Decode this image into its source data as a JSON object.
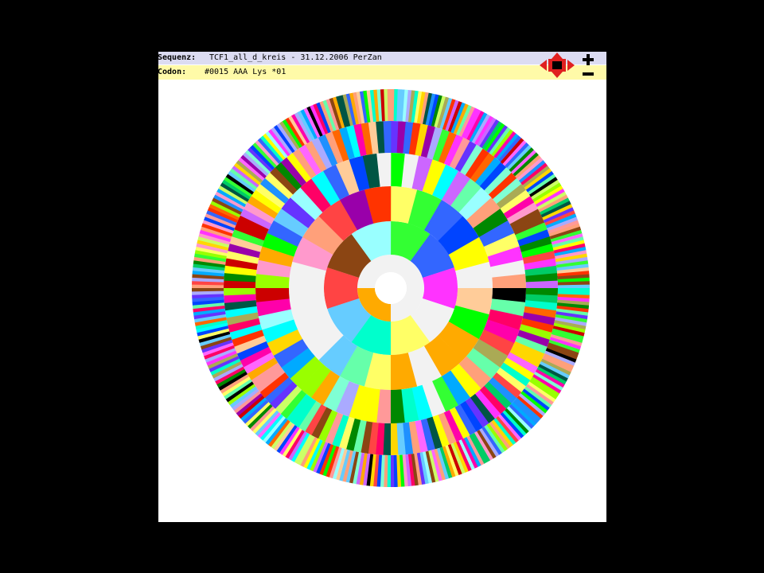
{
  "sequence": {
    "label": "Sequenz:",
    "value": "TCF1_all_d_kreis - 31.12.2006 PerZan"
  },
  "codon": {
    "label": "Codon:",
    "value": "#0015 AAA Lys *01"
  },
  "icons": {
    "navigation": "nav-arrows-icon",
    "zoom_in": "plus-icon",
    "zoom_out": "minus-icon"
  },
  "colors": {
    "page_background": "#000000",
    "viewer_background": "#ffffff",
    "sequence_bar": "#dcdcf2",
    "codon_bar": "#fffaa8",
    "nav_arrows": "#e02020",
    "empty_segment": "#f2f2f2"
  }
}
